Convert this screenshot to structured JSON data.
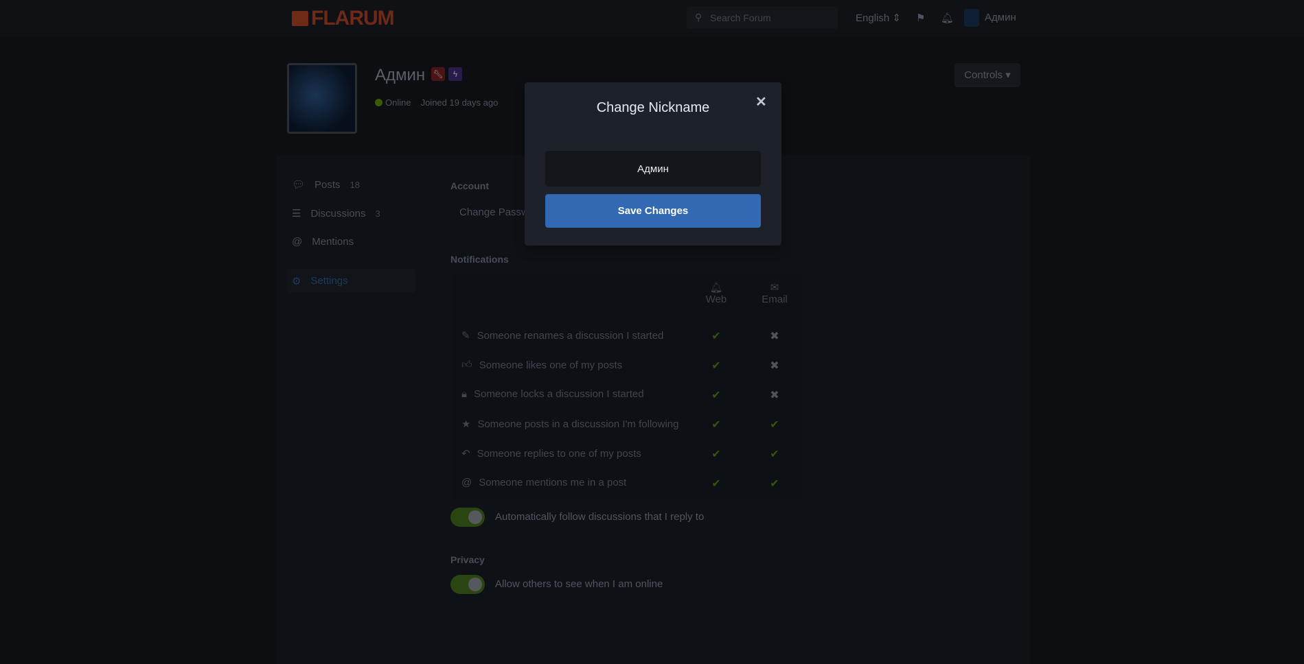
{
  "header": {
    "logo": "FLARUM",
    "search_placeholder": "Search Forum",
    "language": "English",
    "user": "Админ"
  },
  "profile": {
    "name": "Админ",
    "status": "Online",
    "joined": "Joined 19 days ago",
    "controls": "Controls ▾"
  },
  "sidebar": {
    "items": [
      {
        "label": "Posts",
        "count": "18"
      },
      {
        "label": "Discussions",
        "count": "3"
      },
      {
        "label": "Mentions"
      },
      {
        "label": "Settings"
      }
    ]
  },
  "account": {
    "title": "Account",
    "change_password": "Change Password"
  },
  "notifications": {
    "title": "Notifications",
    "col_web": "Web",
    "col_email": "Email",
    "rows": [
      {
        "label": "Someone renames a discussion I started",
        "web": "✔",
        "email": "✖"
      },
      {
        "label": "Someone likes one of my posts",
        "web": "✔",
        "email": "✖"
      },
      {
        "label": "Someone locks a discussion I started",
        "web": "✔",
        "email": "✖"
      },
      {
        "label": "Someone posts in a discussion I'm following",
        "web": "✔",
        "email": "✔"
      },
      {
        "label": "Someone replies to one of my posts",
        "web": "✔",
        "email": "✔"
      },
      {
        "label": "Someone mentions me in a post",
        "web": "✔",
        "email": "✔"
      }
    ],
    "auto_follow": "Automatically follow discussions that I reply to"
  },
  "privacy": {
    "title": "Privacy",
    "online": "Allow others to see when I am online"
  },
  "modal": {
    "title": "Change Nickname",
    "close": "✕",
    "value": "Админ",
    "save": "Save Changes"
  },
  "colors": {
    "primary": "#3369b3",
    "brand": "#e7562e",
    "success": "#7fba00"
  }
}
